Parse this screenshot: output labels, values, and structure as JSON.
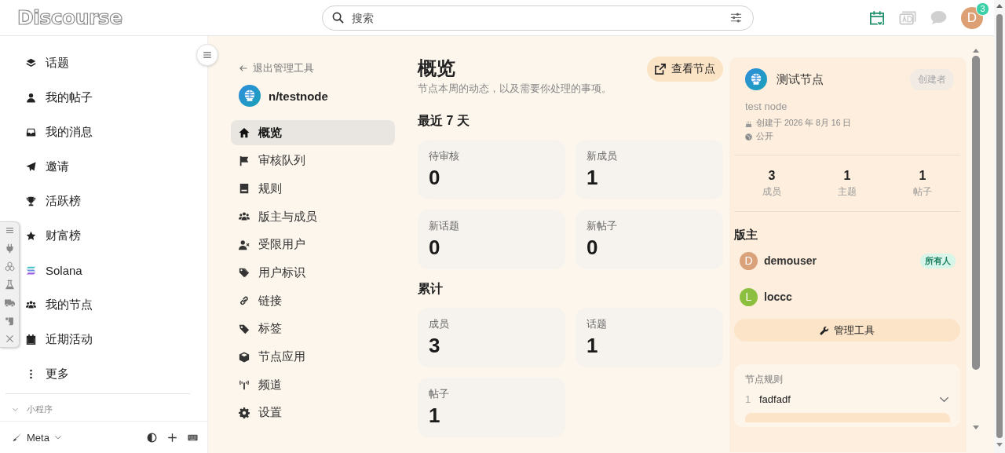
{
  "header": {
    "logo": "Discourse",
    "search": {
      "placeholder": "搜索"
    },
    "avatar": "D",
    "notification_count": "3"
  },
  "sidebar": {
    "items": [
      {
        "label": "话题"
      },
      {
        "label": "我的帖子"
      },
      {
        "label": "我的消息"
      },
      {
        "label": "邀请"
      },
      {
        "label": "活跃榜"
      },
      {
        "label": "财富榜"
      },
      {
        "label": "Solana"
      },
      {
        "label": "我的节点"
      },
      {
        "label": "近期活动"
      },
      {
        "label": "更多"
      }
    ],
    "section": {
      "title": "小程序"
    },
    "footer": {
      "theme": "Meta"
    }
  },
  "admin_nav": {
    "back": "退出管理工具",
    "node": "n/testnode",
    "items": [
      {
        "label": "概览",
        "selected": true
      },
      {
        "label": "审核队列",
        "selected": false
      },
      {
        "label": "规则",
        "selected": false
      },
      {
        "label": "版主与成员",
        "selected": false
      },
      {
        "label": "受限用户",
        "selected": false
      },
      {
        "label": "用户标识",
        "selected": false
      },
      {
        "label": "链接",
        "selected": false
      },
      {
        "label": "标签",
        "selected": false
      },
      {
        "label": "节点应用",
        "selected": false
      },
      {
        "label": "频道",
        "selected": false
      },
      {
        "label": "设置",
        "selected": false
      }
    ]
  },
  "overview": {
    "title": "概览",
    "subtitle": "节点本周的动态，以及需要你处理的事项。",
    "view_button": "查看节点",
    "sections": [
      {
        "title": "最近 7 天",
        "cards": [
          {
            "label": "待审核",
            "value": "0"
          },
          {
            "label": "新成员",
            "value": "1"
          },
          {
            "label": "新话题",
            "value": "0"
          },
          {
            "label": "新帖子",
            "value": "0"
          }
        ]
      },
      {
        "title": "累计",
        "cards": [
          {
            "label": "成员",
            "value": "3"
          },
          {
            "label": "话题",
            "value": "1"
          },
          {
            "label": "帖子",
            "value": "1"
          }
        ]
      }
    ]
  },
  "node_panel": {
    "name": "测试节点",
    "role_badge": "创建者",
    "description": "test node",
    "created": "创建于 2026 年 8月 16 日",
    "visibility": "公开",
    "stats": [
      {
        "value": "3",
        "label": "成员"
      },
      {
        "value": "1",
        "label": "主题"
      },
      {
        "value": "1",
        "label": "帖子"
      }
    ],
    "moderators_title": "版主",
    "moderators": [
      {
        "initial": "D",
        "name": "demouser",
        "color": "#d9a27b",
        "badge": "所有人"
      },
      {
        "initial": "L",
        "name": "loccc",
        "color": "#8cbf3f"
      }
    ],
    "manage_button": "管理工具",
    "rules": {
      "title": "节点规则",
      "items": [
        {
          "number": "1",
          "text": "fadfadf",
          "expanded": false
        }
      ]
    }
  }
}
